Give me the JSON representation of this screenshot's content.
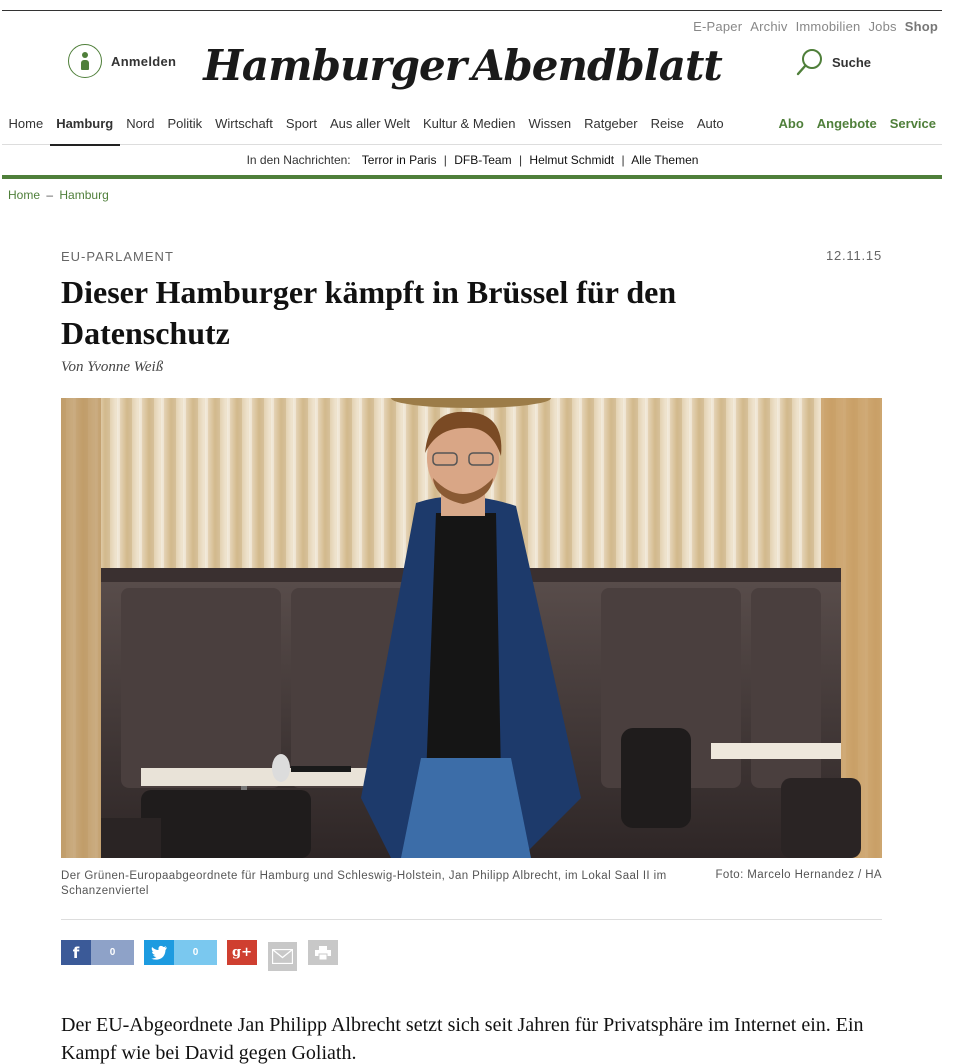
{
  "header": {
    "top_links": [
      "E-Paper",
      "Archiv",
      "Immobilien",
      "Jobs"
    ],
    "shop_label": "Shop",
    "login_label": "Anmelden",
    "logo_left": "Hamburger",
    "logo_right": "Abendblatt",
    "search_label": "Suche"
  },
  "nav": {
    "items": [
      "Home",
      "Hamburg",
      "Nord",
      "Politik",
      "Wirtschaft",
      "Sport",
      "Aus aller Welt",
      "Kultur & Medien",
      "Wissen",
      "Ratgeber",
      "Reise",
      "Auto"
    ],
    "active": "Hamburg",
    "right_items": [
      "Abo",
      "Angebote",
      "Service"
    ]
  },
  "news_bar": {
    "prefix": "In den Nachrichten:",
    "links": [
      "Terror in Paris",
      "DFB-Team",
      "Helmut Schmidt",
      "Alle Themen"
    ],
    "separator": "|"
  },
  "breadcrumb": {
    "items": [
      "Home",
      "Hamburg"
    ],
    "separator": "–"
  },
  "article": {
    "kicker": "EU-PARLAMENT",
    "date": "12.11.15",
    "headline": "Dieser Hamburger kämpft in Brüssel für den Datenschutz",
    "byline": "Von Yvonne Weiß",
    "caption": "Der Grünen-Europaabgeordnete für Hamburg und Schleswig-Holstein, Jan Philipp Albrecht, im Lokal Saal II im Schanzenviertel",
    "credit": "Foto: Marcelo Hernandez / HA",
    "teaser": "Der EU-Abgeordnete Jan Philipp Albrecht setzt sich seit Jahren für Privatsphäre im Internet ein. Ein Kampf wie bei David gegen Goliath."
  },
  "share": {
    "facebook_icon": "f",
    "facebook_count": "0",
    "twitter_count": "0",
    "googleplus_icon": "g+"
  },
  "colors": {
    "brand_green": "#4f7f3a",
    "facebook": "#3b5a98",
    "twitter": "#1d9be0",
    "googleplus": "#cf3f30"
  },
  "icons": [
    "user-icon",
    "seal-icon",
    "search-icon",
    "twitter-bird-icon",
    "mail-icon",
    "print-icon"
  ]
}
